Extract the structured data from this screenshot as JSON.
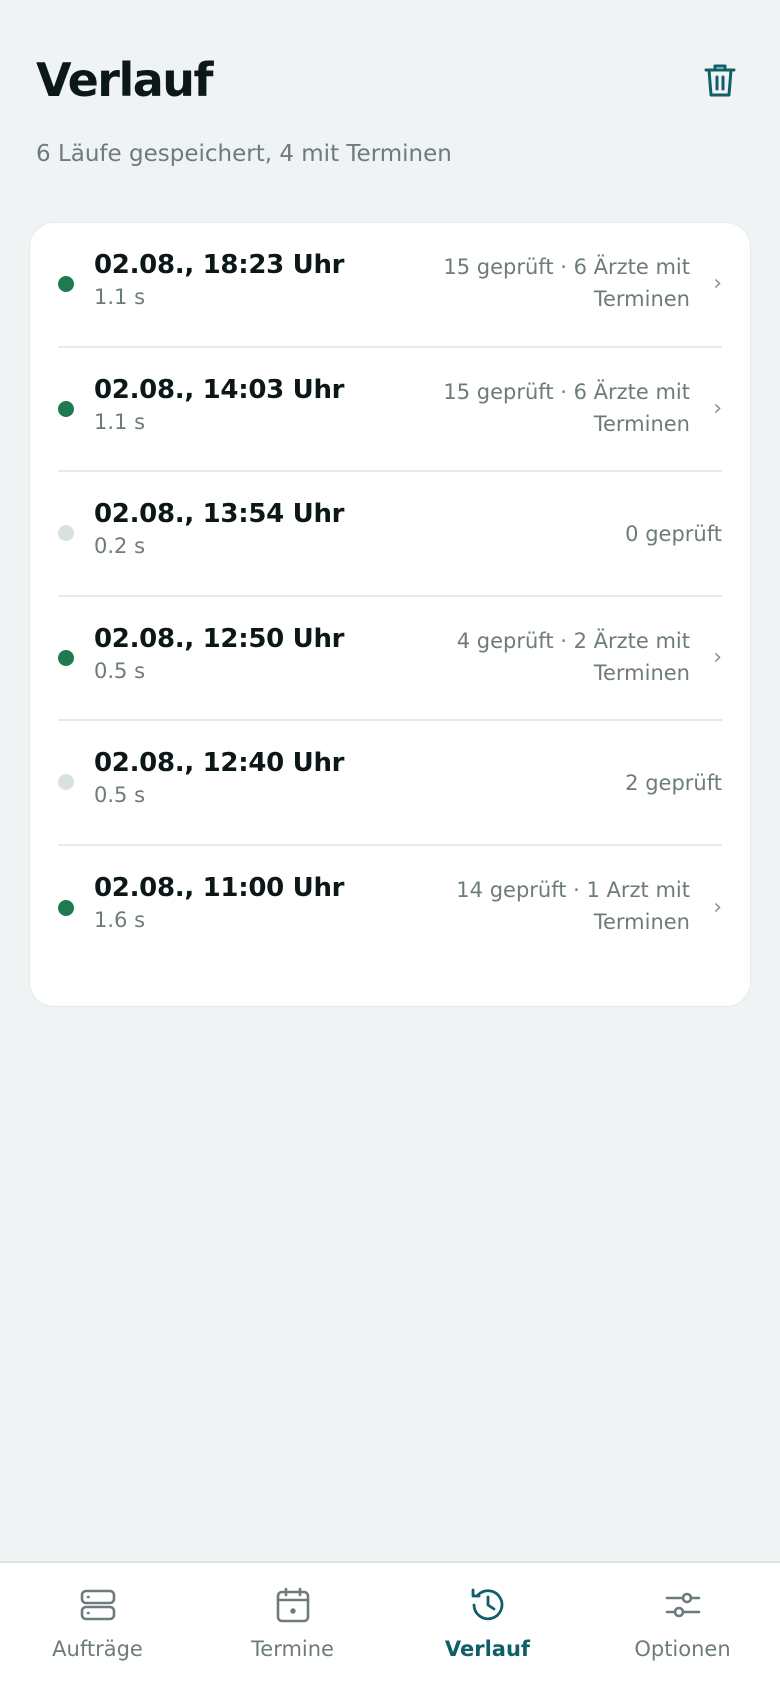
{
  "header": {
    "title": "Verlauf",
    "subtitle": "6 Läufe gespeichert, 4 mit Terminen"
  },
  "runs": [
    {
      "time": "02.08., 18:23 Uhr",
      "duration": "1.1 s",
      "summary": "15 geprüft · 6 Ärzte mit Terminen",
      "has_appointments": true
    },
    {
      "time": "02.08., 14:03 Uhr",
      "duration": "1.1 s",
      "summary": "15 geprüft · 6 Ärzte mit Terminen",
      "has_appointments": true
    },
    {
      "time": "02.08., 13:54 Uhr",
      "duration": "0.2 s",
      "summary": "0 geprüft",
      "has_appointments": false
    },
    {
      "time": "02.08., 12:50 Uhr",
      "duration": "0.5 s",
      "summary": "4 geprüft · 2 Ärzte mit Terminen",
      "has_appointments": true
    },
    {
      "time": "02.08., 12:40 Uhr",
      "duration": "0.5 s",
      "summary": "2 geprüft",
      "has_appointments": false
    },
    {
      "time": "02.08., 11:00 Uhr",
      "duration": "1.6 s",
      "summary": "14 geprüft · 1 Arzt mit Terminen",
      "has_appointments": true
    }
  ],
  "nav": {
    "items": [
      {
        "label": "Aufträge",
        "icon": "server-icon",
        "active": false
      },
      {
        "label": "Termine",
        "icon": "calendar-icon",
        "active": false
      },
      {
        "label": "Verlauf",
        "icon": "history-icon",
        "active": true
      },
      {
        "label": "Optionen",
        "icon": "sliders-icon",
        "active": false
      }
    ]
  },
  "colors": {
    "accent": "#0f5f68",
    "dot_active": "#1f7a4f",
    "dot_inactive": "#d9e1e0",
    "background": "#eff3f4"
  }
}
